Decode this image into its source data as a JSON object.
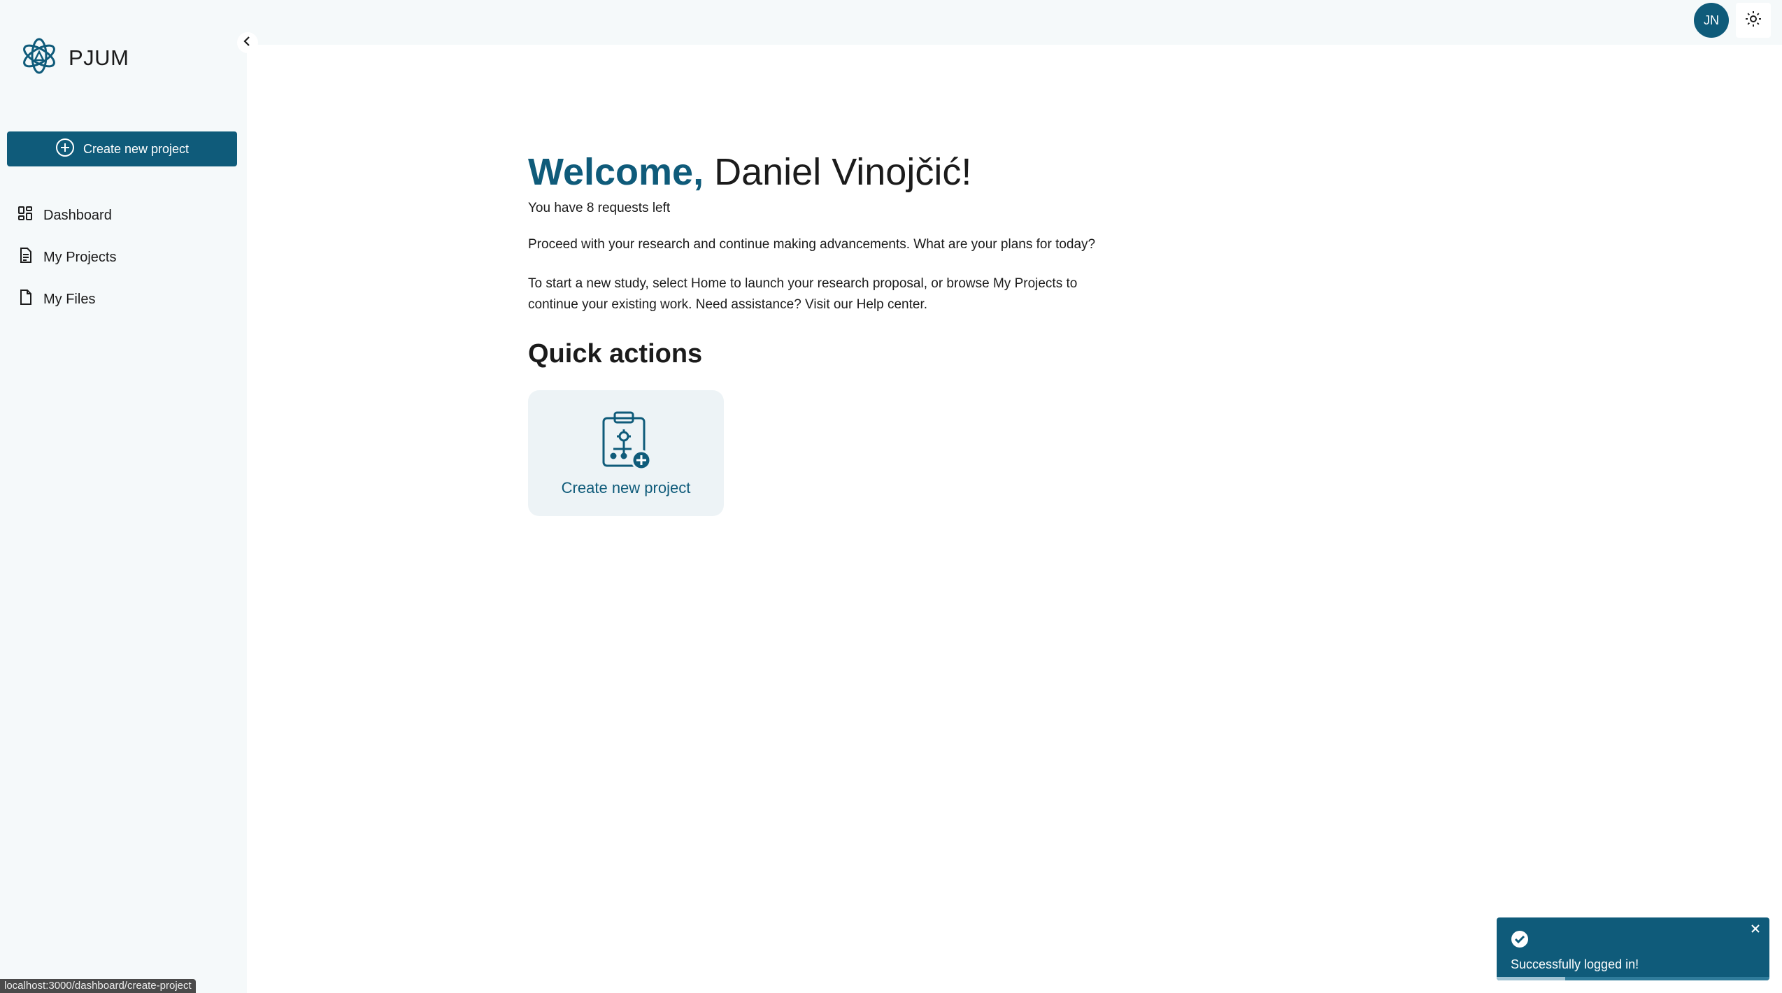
{
  "brand": {
    "name": "PJUM",
    "accent": "#0f5b7a"
  },
  "sidebar": {
    "create_label": "Create new project",
    "items": [
      {
        "label": "Dashboard",
        "icon": "dashboard-icon"
      },
      {
        "label": "My Projects",
        "icon": "document-lines-icon"
      },
      {
        "label": "My Files",
        "icon": "file-icon"
      }
    ]
  },
  "topbar": {
    "avatar_initials": "JN",
    "theme_icon": "sun-icon"
  },
  "main": {
    "welcome_prefix": "Welcome,",
    "user_name": "Daniel Vinojčić!",
    "requests_text": "You have 8 requests left",
    "paragraph1": "Proceed with your research and continue making advancements. What are your plans for today?",
    "paragraph2": "To start a new study, select Home to launch your research proposal, or browse My Projects to continue your existing work. Need assistance? Visit our Help center.",
    "quick_actions_title": "Quick actions",
    "quick_card_label": "Create new project"
  },
  "toast": {
    "message": "Successfully logged in!",
    "progress_percent": 25
  },
  "status_url": "localhost:3000/dashboard/create-project"
}
